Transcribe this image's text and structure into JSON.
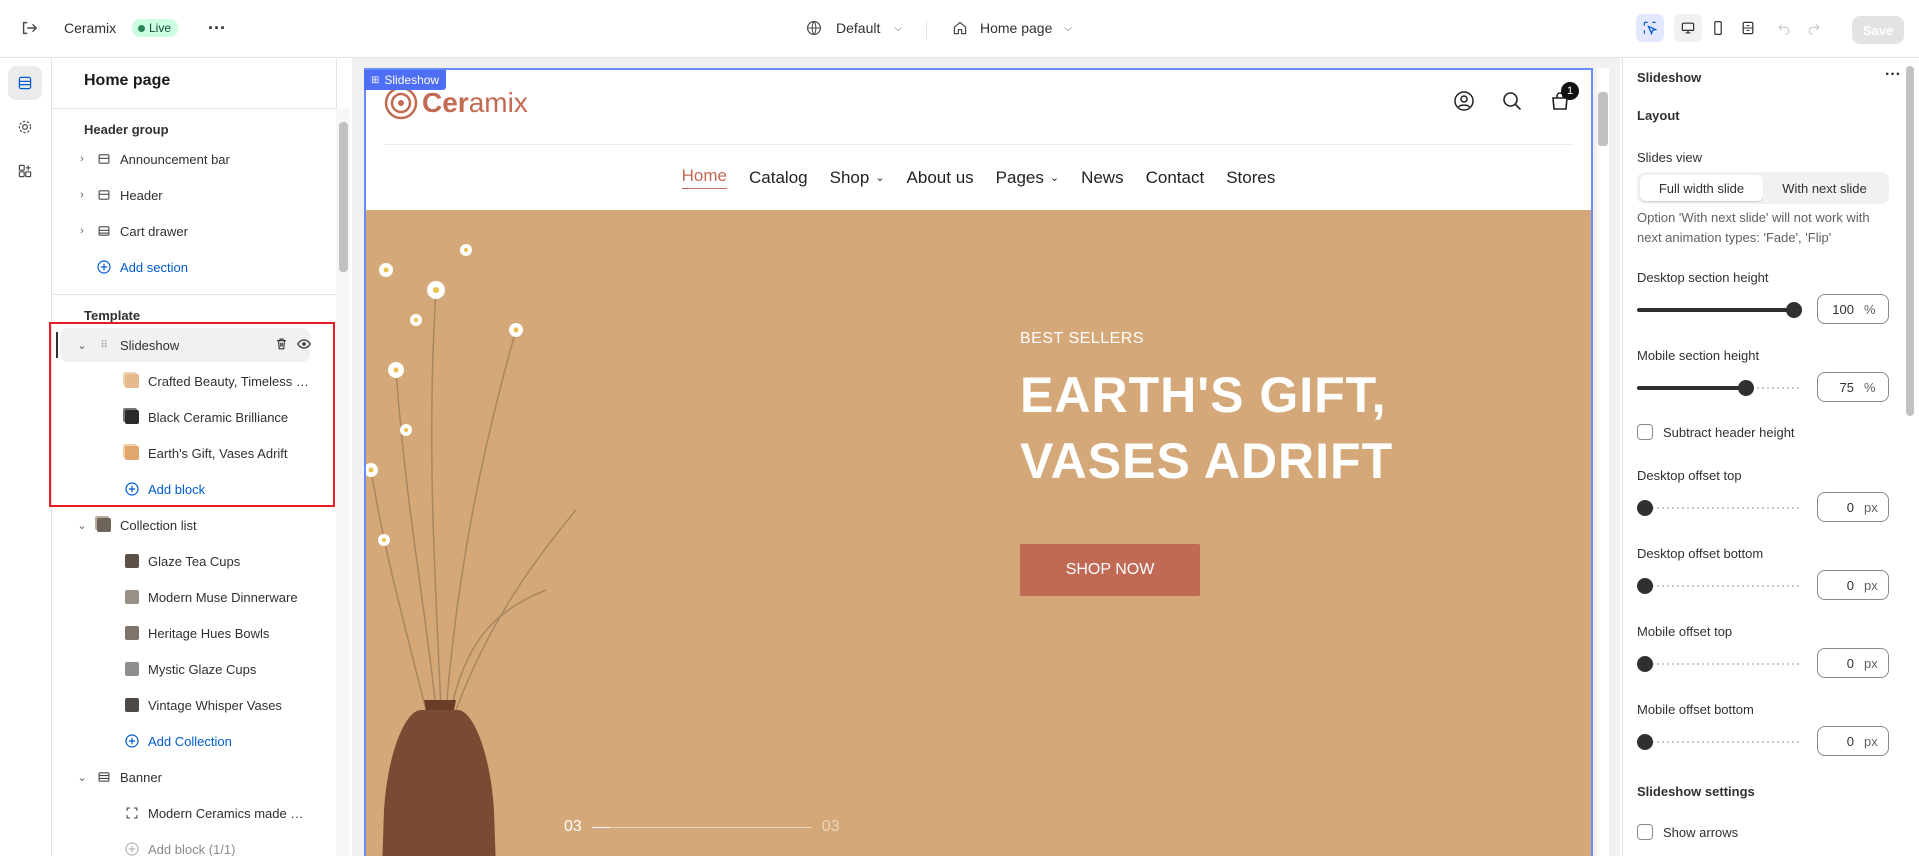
{
  "topbar": {
    "store_name": "Ceramix",
    "status": "Live",
    "theme_label": "Default",
    "page_label": "Home page",
    "save_label": "Save"
  },
  "sidebar": {
    "title": "Home page",
    "header_group_label": "Header group",
    "header_items": [
      {
        "label": "Announcement bar"
      },
      {
        "label": "Header"
      },
      {
        "label": "Cart drawer"
      }
    ],
    "add_section_label": "Add section",
    "template_label": "Template",
    "slideshow": {
      "label": "Slideshow",
      "blocks": [
        {
          "label": "Crafted Beauty, Timeless G..."
        },
        {
          "label": "Black Ceramic Brilliance"
        },
        {
          "label": "Earth's Gift, Vases Adrift"
        }
      ],
      "add_label": "Add block"
    },
    "collection_list": {
      "label": "Collection list",
      "blocks": [
        {
          "label": "Glaze Tea Cups"
        },
        {
          "label": "Modern Muse Dinnerware"
        },
        {
          "label": "Heritage Hues Bowls"
        },
        {
          "label": "Mystic Glaze Cups"
        },
        {
          "label": "Vintage Whisper Vases"
        }
      ],
      "add_label": "Add Collection"
    },
    "banner": {
      "label": "Banner",
      "blocks": [
        {
          "label": "Modern Ceramics made up ..."
        }
      ],
      "add_label": "Add block (1/1)"
    }
  },
  "preview": {
    "section_tag": "Slideshow",
    "logo_text_bold": "Cer",
    "logo_text_light": "amix",
    "cart_count": "1",
    "nav": [
      {
        "label": "Home",
        "active": true
      },
      {
        "label": "Catalog"
      },
      {
        "label": "Shop",
        "dropdown": true
      },
      {
        "label": "About us"
      },
      {
        "label": "Pages",
        "dropdown": true
      },
      {
        "label": "News"
      },
      {
        "label": "Contact"
      },
      {
        "label": "Stores"
      }
    ],
    "hero": {
      "subtitle": "BEST SELLERS",
      "title_line1": "EARTH'S GIFT,",
      "title_line2": "VASES ADRIFT",
      "button": "SHOP NOW",
      "pager_current": "03",
      "pager_total": "03"
    }
  },
  "settings": {
    "title": "Slideshow",
    "layout_heading": "Layout",
    "slides_view_label": "Slides view",
    "slides_view_options": [
      "Full width slide",
      "With next slide"
    ],
    "slides_view_selected": "Full width slide",
    "note": "Option 'With next slide' will not work with next animation types: 'Fade', 'Flip'",
    "desktop_section_height": {
      "label": "Desktop section height",
      "value": "100",
      "unit": "%",
      "fraction": 1.0
    },
    "mobile_section_height": {
      "label": "Mobile section height",
      "value": "75",
      "unit": "%",
      "fraction": 0.66
    },
    "subtract_header_label": "Subtract header height",
    "desktop_offset_top": {
      "label": "Desktop offset top",
      "value": "0",
      "unit": "px",
      "fraction": 0
    },
    "desktop_offset_bottom": {
      "label": "Desktop offset bottom",
      "value": "0",
      "unit": "px",
      "fraction": 0
    },
    "mobile_offset_top": {
      "label": "Mobile offset top",
      "value": "0",
      "unit": "px",
      "fraction": 0
    },
    "mobile_offset_bottom": {
      "label": "Mobile offset bottom",
      "value": "0",
      "unit": "px",
      "fraction": 0
    },
    "slideshow_settings_heading": "Slideshow settings",
    "show_arrows_label": "Show arrows"
  },
  "colors": {
    "accent": "#005bd3",
    "brand": "#c36a52",
    "hero_bg": "#d4a878",
    "selection": "#4d6ef5",
    "highlight_box": "#e51c23"
  }
}
